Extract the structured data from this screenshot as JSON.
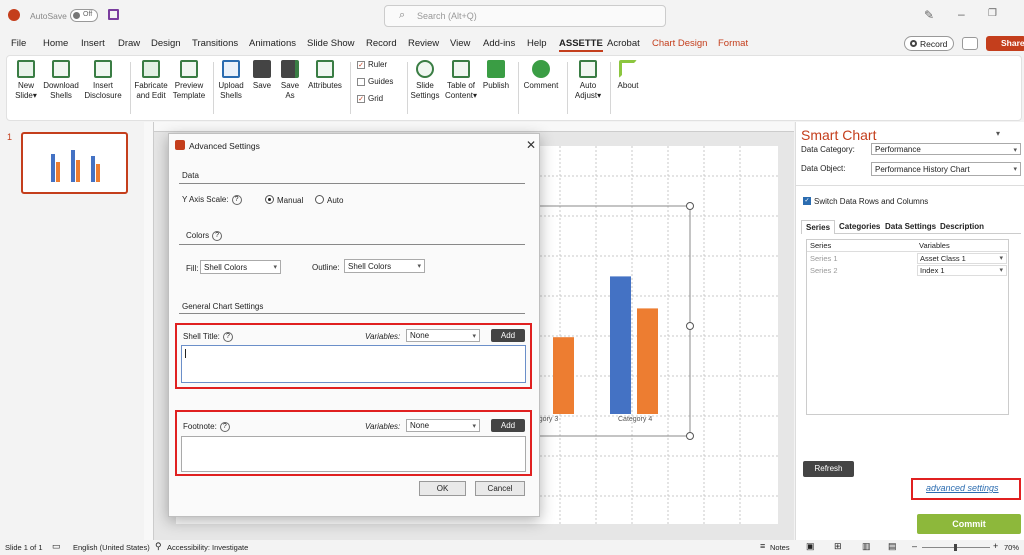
{
  "titlebar": {
    "autosave": "AutoSave",
    "toggle": "Off",
    "search_placeholder": "Search (Alt+Q)"
  },
  "menu": {
    "items": [
      "File",
      "Home",
      "Insert",
      "Draw",
      "Design",
      "Transitions",
      "Animations",
      "Slide Show",
      "Record",
      "Review",
      "View",
      "Add-ins",
      "Help",
      "ASSETTE",
      "Acrobat",
      "Chart Design",
      "Format"
    ],
    "record_button": "Record",
    "share_button": "Share"
  },
  "ribbon": {
    "new_slide": [
      "New",
      "Slide"
    ],
    "download_shells": [
      "Download",
      "Shells"
    ],
    "insert_disclosure": [
      "Insert",
      "Disclosure"
    ],
    "fabricate": [
      "Fabricate",
      "and Edit"
    ],
    "preview": [
      "Preview",
      "Template"
    ],
    "upload": [
      "Upload",
      "Shells"
    ],
    "save": "Save",
    "save_as": [
      "Save",
      "As"
    ],
    "attributes": "Attributes",
    "ruler": "Ruler",
    "guides": "Guides",
    "grid": "Grid",
    "slide_settings": [
      "Slide",
      "Settings"
    ],
    "toc": [
      "Table of",
      "Content"
    ],
    "publish": "Publish",
    "comment": "Comment",
    "auto_adjust": [
      "Auto",
      "Adjust"
    ],
    "about": "About"
  },
  "thumbnails": {
    "slide_number": "1"
  },
  "chart": {
    "category3": "Category 3",
    "category4": "Category 4"
  },
  "chart_data": {
    "type": "bar",
    "categories": [
      "Category 3",
      "Category 4"
    ],
    "series": [
      {
        "values": [
          0,
          4.3
        ]
      },
      {
        "values": [
          2.4,
          3.3
        ]
      }
    ],
    "colors": [
      "#4472c4",
      "#ed7d31"
    ]
  },
  "dialog": {
    "title": "Advanced Settings",
    "data_section": "Data",
    "y_axis_scale": "Y Axis Scale:",
    "manual": "Manual",
    "auto": "Auto",
    "colors_section": "Colors",
    "fill_label": "Fill:",
    "fill_value": "Shell Colors",
    "outline_label": "Outline:",
    "outline_value": "Shell Colors",
    "general_section": "General Chart Settings",
    "shell_title": "Shell Title:",
    "variables": "Variables:",
    "none": "None",
    "add": "Add",
    "footnote": "Footnote:",
    "ok": "OK",
    "cancel": "Cancel"
  },
  "panel": {
    "title": "Smart Chart",
    "data_category_label": "Data Category:",
    "data_category_value": "Performance",
    "data_object_label": "Data Object:",
    "data_object_value": "Performance History Chart",
    "switch_label": "Switch Data Rows and Columns",
    "tabs": [
      "Series",
      "Categories",
      "Data Settings",
      "Description"
    ],
    "table_headers": [
      "Series",
      "Variables"
    ],
    "rows": [
      {
        "series": "Series 1",
        "variable": "Asset Class 1"
      },
      {
        "series": "Series 2",
        "variable": "Index 1"
      }
    ],
    "refresh": "Refresh",
    "advanced_link": "advanced settings",
    "commit": "Commit"
  },
  "status": {
    "slide_of": "Slide 1 of 1",
    "language": "English (United States)",
    "accessibility": "Accessibility: Investigate",
    "notes": "Notes",
    "zoom": "70%"
  }
}
